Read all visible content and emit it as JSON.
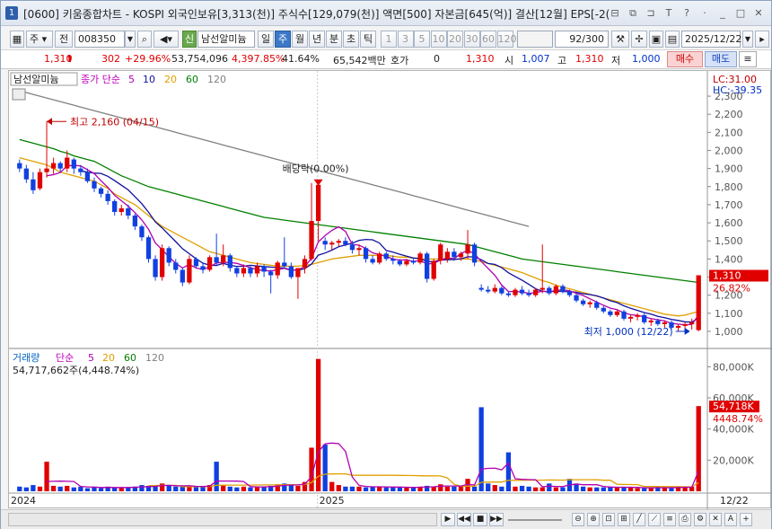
{
  "window": {
    "app_no": "1",
    "title": "[0600] 키움종합차트 - KOSPI 외국인보유[3,313(천)] 주식수[129,079(천)] 액면[500] 자본금[645(억)] 결산[12월] EPS[-2("
  },
  "toolbar": {
    "market": "주",
    "prefix": "전",
    "code": "008350",
    "credit": "신",
    "name": "남선알미늄",
    "periods": [
      "일",
      "주",
      "월",
      "년",
      "분",
      "초",
      "틱"
    ],
    "active_period": "주",
    "intervals": [
      "1",
      "3",
      "5",
      "10",
      "20",
      "30",
      "60",
      "120"
    ],
    "count": "92/300",
    "date": "2025/12/22"
  },
  "quote": {
    "price": "1,310",
    "change": "302",
    "rate": "+29.96%",
    "volume": "53,754,096",
    "vol_rate": "4,397.85%",
    "turnover": "41.64%",
    "amount": "65,542백만",
    "hoga_label": "호가",
    "hoga_value": "0",
    "cur": "1,310",
    "open_label": "시",
    "open": "1,007",
    "high_label": "고",
    "high": "1,310",
    "low_label": "저",
    "low": "1,000",
    "buy_label": "매수",
    "sell_label": "매도"
  },
  "price_panel": {
    "title": "남선알미늄",
    "legend_prefix": "종가 단순",
    "ma_labels": [
      "5",
      "10",
      "20",
      "60",
      "120"
    ],
    "ma_colors": [
      "#b000b0",
      "#1010a0",
      "#e0a000",
      "#008000",
      "#808080"
    ],
    "lc": "LC:31.00",
    "hc": "HC:-39.35",
    "y_ticks": [
      "2,300",
      "2,200",
      "2,100",
      "2,000",
      "1,900",
      "1,800",
      "1,700",
      "1,600",
      "1,500",
      "1,400",
      "1,300",
      "1,200",
      "1,100",
      "1,000"
    ],
    "last_price_tag": "1,310",
    "last_rate_tag": "26.82%",
    "high_annot": "최고 2,160 (04/15)",
    "low_annot": "최저 1,000 (12/22)",
    "event_annot": "배당락(0.00%)"
  },
  "volume_panel": {
    "title": "거래량",
    "legend_prefix": "단순",
    "ma_labels": [
      "5",
      "20",
      "60",
      "120"
    ],
    "ma_colors": [
      "#b000b0",
      "#e0a000",
      "#008000",
      "#808080"
    ],
    "info": "54,717,662주(4,448.74%)",
    "y_ticks": [
      "80,000K",
      "60,000K",
      "40,000K",
      "20,000K"
    ],
    "tag_value": "54,718K",
    "tag_rate": "4448.74%"
  },
  "x_axis": {
    "labels": [
      "2024",
      "2025"
    ],
    "right_label": "12/22"
  },
  "colors": {
    "up": "#e00000",
    "down": "#1040e0"
  },
  "chart_data": {
    "type": "candlestick",
    "title": "남선알미늄",
    "ylim": [
      950,
      2350
    ],
    "candles": [
      [
        1930,
        1950,
        1880,
        1900
      ],
      [
        1900,
        1920,
        1820,
        1840
      ],
      [
        1840,
        1880,
        1760,
        1780
      ],
      [
        1790,
        1900,
        1780,
        1880
      ],
      [
        1880,
        2160,
        1850,
        1900
      ],
      [
        1900,
        1960,
        1870,
        1930
      ],
      [
        1930,
        1940,
        1880,
        1900
      ],
      [
        1900,
        2000,
        1880,
        1960
      ],
      [
        1950,
        1960,
        1870,
        1900
      ],
      [
        1900,
        1920,
        1860,
        1880
      ],
      [
        1880,
        1900,
        1820,
        1830
      ],
      [
        1830,
        1850,
        1770,
        1790
      ],
      [
        1790,
        1800,
        1740,
        1760
      ],
      [
        1760,
        1780,
        1700,
        1720
      ],
      [
        1720,
        1730,
        1640,
        1660
      ],
      [
        1660,
        1700,
        1640,
        1680
      ],
      [
        1680,
        1700,
        1620,
        1640
      ],
      [
        1640,
        1650,
        1560,
        1580
      ],
      [
        1580,
        1590,
        1500,
        1520
      ],
      [
        1520,
        1530,
        1380,
        1400
      ],
      [
        1400,
        1420,
        1280,
        1300
      ],
      [
        1300,
        1480,
        1280,
        1460
      ],
      [
        1460,
        1470,
        1360,
        1380
      ],
      [
        1380,
        1400,
        1320,
        1340
      ],
      [
        1340,
        1350,
        1250,
        1270
      ],
      [
        1270,
        1420,
        1260,
        1400
      ],
      [
        1400,
        1410,
        1350,
        1360
      ],
      [
        1360,
        1380,
        1320,
        1340
      ],
      [
        1340,
        1420,
        1330,
        1410
      ],
      [
        1410,
        1540,
        1360,
        1380
      ],
      [
        1380,
        1480,
        1360,
        1420
      ],
      [
        1420,
        1430,
        1330,
        1350
      ],
      [
        1350,
        1360,
        1300,
        1320
      ],
      [
        1320,
        1370,
        1300,
        1350
      ],
      [
        1350,
        1360,
        1300,
        1320
      ],
      [
        1320,
        1380,
        1300,
        1360
      ],
      [
        1360,
        1370,
        1300,
        1330
      ],
      [
        1330,
        1340,
        1210,
        1310
      ],
      [
        1310,
        1390,
        1290,
        1380
      ],
      [
        1380,
        1520,
        1350,
        1360
      ],
      [
        1360,
        1380,
        1290,
        1300
      ],
      [
        1300,
        1320,
        1180,
        1350
      ],
      [
        1350,
        1420,
        1320,
        1400
      ],
      [
        1400,
        1820,
        1390,
        1610
      ],
      [
        1610,
        1830,
        1500,
        1810
      ],
      [
        1500,
        1520,
        1450,
        1480
      ],
      [
        1480,
        1500,
        1450,
        1490
      ],
      [
        1490,
        1510,
        1470,
        1500
      ],
      [
        1500,
        1520,
        1470,
        1480
      ],
      [
        1480,
        1500,
        1430,
        1450
      ],
      [
        1450,
        1480,
        1420,
        1460
      ],
      [
        1460,
        1470,
        1380,
        1400
      ],
      [
        1400,
        1420,
        1370,
        1380
      ],
      [
        1380,
        1440,
        1370,
        1430
      ],
      [
        1430,
        1440,
        1390,
        1400
      ],
      [
        1400,
        1420,
        1370,
        1390
      ],
      [
        1390,
        1400,
        1360,
        1370
      ],
      [
        1370,
        1400,
        1360,
        1390
      ],
      [
        1390,
        1400,
        1370,
        1380
      ],
      [
        1380,
        1440,
        1370,
        1430
      ],
      [
        1430,
        1440,
        1270,
        1290
      ],
      [
        1290,
        1400,
        1280,
        1390
      ],
      [
        1390,
        1490,
        1370,
        1480
      ],
      [
        1400,
        1460,
        1380,
        1440
      ],
      [
        1440,
        1460,
        1390,
        1410
      ],
      [
        1410,
        1440,
        1390,
        1430
      ],
      [
        1430,
        1560,
        1400,
        1480
      ],
      [
        1480,
        1490,
        1360,
        1380
      ],
      [
        1240,
        1260,
        1220,
        1230
      ],
      [
        1230,
        1250,
        1210,
        1220
      ],
      [
        1220,
        1260,
        1210,
        1240
      ],
      [
        1240,
        1250,
        1200,
        1210
      ],
      [
        1210,
        1220,
        1190,
        1200
      ],
      [
        1200,
        1240,
        1190,
        1230
      ],
      [
        1230,
        1250,
        1200,
        1210
      ],
      [
        1210,
        1230,
        1190,
        1200
      ],
      [
        1200,
        1240,
        1190,
        1230
      ],
      [
        1230,
        1480,
        1210,
        1240
      ],
      [
        1240,
        1250,
        1200,
        1210
      ],
      [
        1210,
        1260,
        1200,
        1250
      ],
      [
        1250,
        1260,
        1210,
        1220
      ],
      [
        1220,
        1230,
        1190,
        1200
      ],
      [
        1200,
        1210,
        1160,
        1170
      ],
      [
        1170,
        1180,
        1140,
        1150
      ],
      [
        1150,
        1170,
        1130,
        1160
      ],
      [
        1160,
        1170,
        1120,
        1130
      ],
      [
        1130,
        1140,
        1100,
        1110
      ],
      [
        1110,
        1120,
        1080,
        1090
      ],
      [
        1090,
        1120,
        1080,
        1110
      ],
      [
        1110,
        1120,
        1060,
        1070
      ],
      [
        1070,
        1090,
        1050,
        1080
      ],
      [
        1080,
        1100,
        1060,
        1090
      ],
      [
        1090,
        1100,
        1040,
        1050
      ],
      [
        1050,
        1070,
        1030,
        1060
      ],
      [
        1060,
        1070,
        1030,
        1040
      ],
      [
        1040,
        1060,
        1020,
        1050
      ],
      [
        1050,
        1060,
        1010,
        1020
      ],
      [
        1020,
        1040,
        1000,
        1030
      ],
      [
        1030,
        1050,
        1000,
        1040
      ],
      [
        1040,
        1070,
        1010,
        1050
      ],
      [
        1007,
        1310,
        1000,
        1310
      ]
    ],
    "ma20": [
      1960,
      1950,
      1940,
      1930,
      1920,
      1900,
      1880,
      1870,
      1860,
      1850,
      1840,
      1830,
      1810,
      1790,
      1760,
      1740,
      1720,
      1700,
      1670,
      1640,
      1610,
      1580,
      1560,
      1540,
      1520,
      1500,
      1480,
      1460,
      1440,
      1430,
      1420,
      1410,
      1400,
      1390,
      1380,
      1375,
      1370,
      1365,
      1360,
      1360,
      1360,
      1360,
      1365,
      1370,
      1380,
      1390,
      1400,
      1405,
      1410,
      1415,
      1420,
      1420,
      1420,
      1420,
      1420,
      1415,
      1410,
      1410,
      1405,
      1400,
      1400,
      1400,
      1400,
      1400,
      1400,
      1400,
      1400,
      1395,
      1385,
      1375,
      1365,
      1355,
      1345,
      1335,
      1325,
      1310,
      1295,
      1280,
      1270,
      1255,
      1245,
      1235,
      1225,
      1215,
      1205,
      1195,
      1185,
      1175,
      1165,
      1155,
      1145,
      1135,
      1125,
      1115,
      1105,
      1095,
      1090,
      1085,
      1090,
      1100,
      1110
    ],
    "ma60": [
      2060,
      2050,
      2040,
      2030,
      2020,
      2010,
      1995,
      1985,
      1970,
      1960,
      1950,
      1940,
      1920,
      1900,
      1880,
      1860,
      1845,
      1830,
      1815,
      1800,
      1790,
      1780,
      1770,
      1760,
      1750,
      1740,
      1730,
      1720,
      1710,
      1700,
      1690,
      1680,
      1670,
      1660,
      1650,
      1640,
      1630,
      1625,
      1620,
      1615,
      1610,
      1605,
      1600,
      1595,
      1590,
      1585,
      1580,
      1575,
      1570,
      1565,
      1560,
      1555,
      1550,
      1545,
      1540,
      1535,
      1530,
      1525,
      1520,
      1515,
      1510,
      1505,
      1500,
      1495,
      1490,
      1485,
      1480,
      1470,
      1460,
      1450,
      1440,
      1430,
      1420,
      1410,
      1400,
      1395,
      1390,
      1385,
      1380,
      1375,
      1370,
      1365,
      1360,
      1355,
      1350,
      1345,
      1340,
      1335,
      1330,
      1325,
      1320,
      1315,
      1310,
      1305,
      1300,
      1295,
      1290,
      1285,
      1280,
      1275,
      1270
    ],
    "ma120": [
      2330,
      2320,
      2310,
      2300,
      2290,
      2280,
      2270,
      2260,
      2250,
      2240,
      2230,
      2220,
      2210,
      2200,
      2190,
      2180,
      2170,
      2160,
      2150,
      2140,
      2130,
      2120,
      2110,
      2100,
      2090,
      2080,
      2070,
      2060,
      2050,
      2040,
      2030,
      2020,
      2010,
      2000,
      1990,
      1980,
      1970,
      1960,
      1950,
      1940,
      1930,
      1920,
      1910,
      1900,
      1890,
      1880,
      1870,
      1860,
      1850,
      1840,
      1830,
      1820,
      1810,
      1800,
      1790,
      1780,
      1770,
      1760,
      1750,
      1740,
      1730,
      1720,
      1710,
      1700,
      1690,
      1680,
      1670,
      1660,
      1650,
      1640,
      1630,
      1620,
      1610,
      1600,
      1590,
      1580
    ],
    "volume_ylim": [
      0,
      90000
    ],
    "volumes": [
      3000,
      2500,
      4000,
      3000,
      19000,
      3500,
      3000,
      3500,
      2500,
      3000,
      2000,
      2500,
      2000,
      3000,
      2500,
      2000,
      2500,
      3000,
      4000,
      3500,
      3000,
      5000,
      3500,
      3000,
      3000,
      3500,
      3000,
      3000,
      4000,
      19000,
      4000,
      3000,
      2500,
      3000,
      2500,
      3000,
      3000,
      3500,
      4500,
      5000,
      4000,
      3500,
      6000,
      28000,
      85000,
      30000,
      6000,
      4000,
      3000,
      3000,
      3000,
      2500,
      3000,
      3000,
      2500,
      2500,
      2500,
      2500,
      2500,
      3000,
      3500,
      3000,
      4500,
      3000,
      3000,
      3500,
      8000,
      3000,
      54000,
      5000,
      4000,
      3000,
      25000,
      3000,
      3500,
      3000,
      2500,
      2500,
      5000,
      2500,
      2500,
      8000,
      5000,
      3000,
      2500,
      2500,
      2500,
      3000,
      2500,
      2500,
      2500,
      2000,
      2000,
      2000,
      3000,
      2500,
      2000,
      2500,
      3000,
      3000,
      54718
    ]
  }
}
